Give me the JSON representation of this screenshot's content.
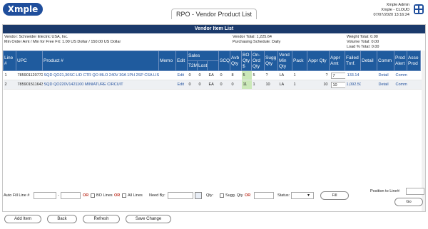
{
  "header": {
    "logo_text": "Xmple",
    "page_title": "RPO - Vendor Product List",
    "user_name": "Xmple Admin",
    "company": "Xmple - CLOUD",
    "datetime": "07/07/2020 13:16:24",
    "brand_color": "#1f4e9c"
  },
  "panel": {
    "title": "Vendor Item List",
    "vendor_label": "Vendor:",
    "vendor_value": "Schneider Electric USA, Inc.",
    "min_order_label": "Min Order Amt / Min for Free Frt:",
    "min_order_value": "1.00 US Dollar / 150.00 US Dollar",
    "vendor_total_label": "Vendor Total:",
    "vendor_total_value": "1,225.64",
    "schedule_label": "Purchasing Schedule:",
    "schedule_value": "Daily",
    "weight_label": "Weight Total:",
    "weight_value": "0.00",
    "volume_label": "Volume Total:",
    "volume_value": "0.00",
    "load_label": "Load % Total:",
    "load_value": "0.00"
  },
  "table": {
    "columns": {
      "line": "Line #",
      "upc": "UPC",
      "product": "Product #",
      "memo": "Memo",
      "edit": "Edit",
      "sales": "Sales",
      "t2m": "T2M",
      "lost": "Lost",
      "scq": "SCQ",
      "avb": "Avb Qty",
      "bo": "BO Qty $",
      "onorder": "On-Ord Qty",
      "sugg": "Sugg Qty",
      "vendmin": "Vend Min Qty",
      "pack": "Pack",
      "appr": "Appr Qty",
      "apprAmt": "Appr Amt",
      "failed": "Failed Trnf.",
      "detail": "Detail",
      "comm": "Comm",
      "alert": "Prod Alert",
      "asso": "Asso Prod"
    },
    "rows": [
      {
        "line": "1",
        "upc": "785901120772",
        "product": "SQD QO21,30SC L/D CTR QO MLO 240V 30A 1PH 2SP CSA LIST",
        "edit": "Edit",
        "sales": "0",
        "t2m": "0",
        "unit": "EA",
        "lost": "0",
        "scq": "8",
        "avb": "5",
        "bo": "5",
        "onorder": "?",
        "sugg": "LA",
        "vendmin": "1",
        "pack": "?",
        "appr": "7",
        "apprAmt": "133.14",
        "detail": "Detail",
        "comm": "Comm"
      },
      {
        "line": "2",
        "upc": "785901511643",
        "product": "SQD QO220V1421100 MINIATURE CIRCUIT",
        "edit": "Edit",
        "sales": "0",
        "t2m": "0",
        "unit": "EA",
        "lost": "0",
        "scq": "0",
        "avb": "11",
        "bo": "1",
        "onorder": "10",
        "sugg": "LA",
        "vendmin": "1",
        "pack": "10",
        "appr": "10",
        "apprAmt": "1,092.50",
        "detail": "Detail",
        "comm": "Comm"
      }
    ]
  },
  "controls": {
    "autofill_label": "Auto Fill Line #",
    "or1": "OR",
    "bo_lines_label": "BO Lines",
    "or2": "OR",
    "all_lines_label": "All Lines",
    "need_by_label": "Need By:",
    "qty_label": "Qty:",
    "sugg_qty_label": "Sugg. Qty",
    "or3": "OR",
    "status_label": "Status:",
    "fill_button": "Fill",
    "position_label": "Position to Line#:",
    "go_button": "Go"
  },
  "footer": {
    "add_item": "Add Item",
    "back": "Back",
    "refresh": "Refresh",
    "save_change": "Save Change"
  }
}
